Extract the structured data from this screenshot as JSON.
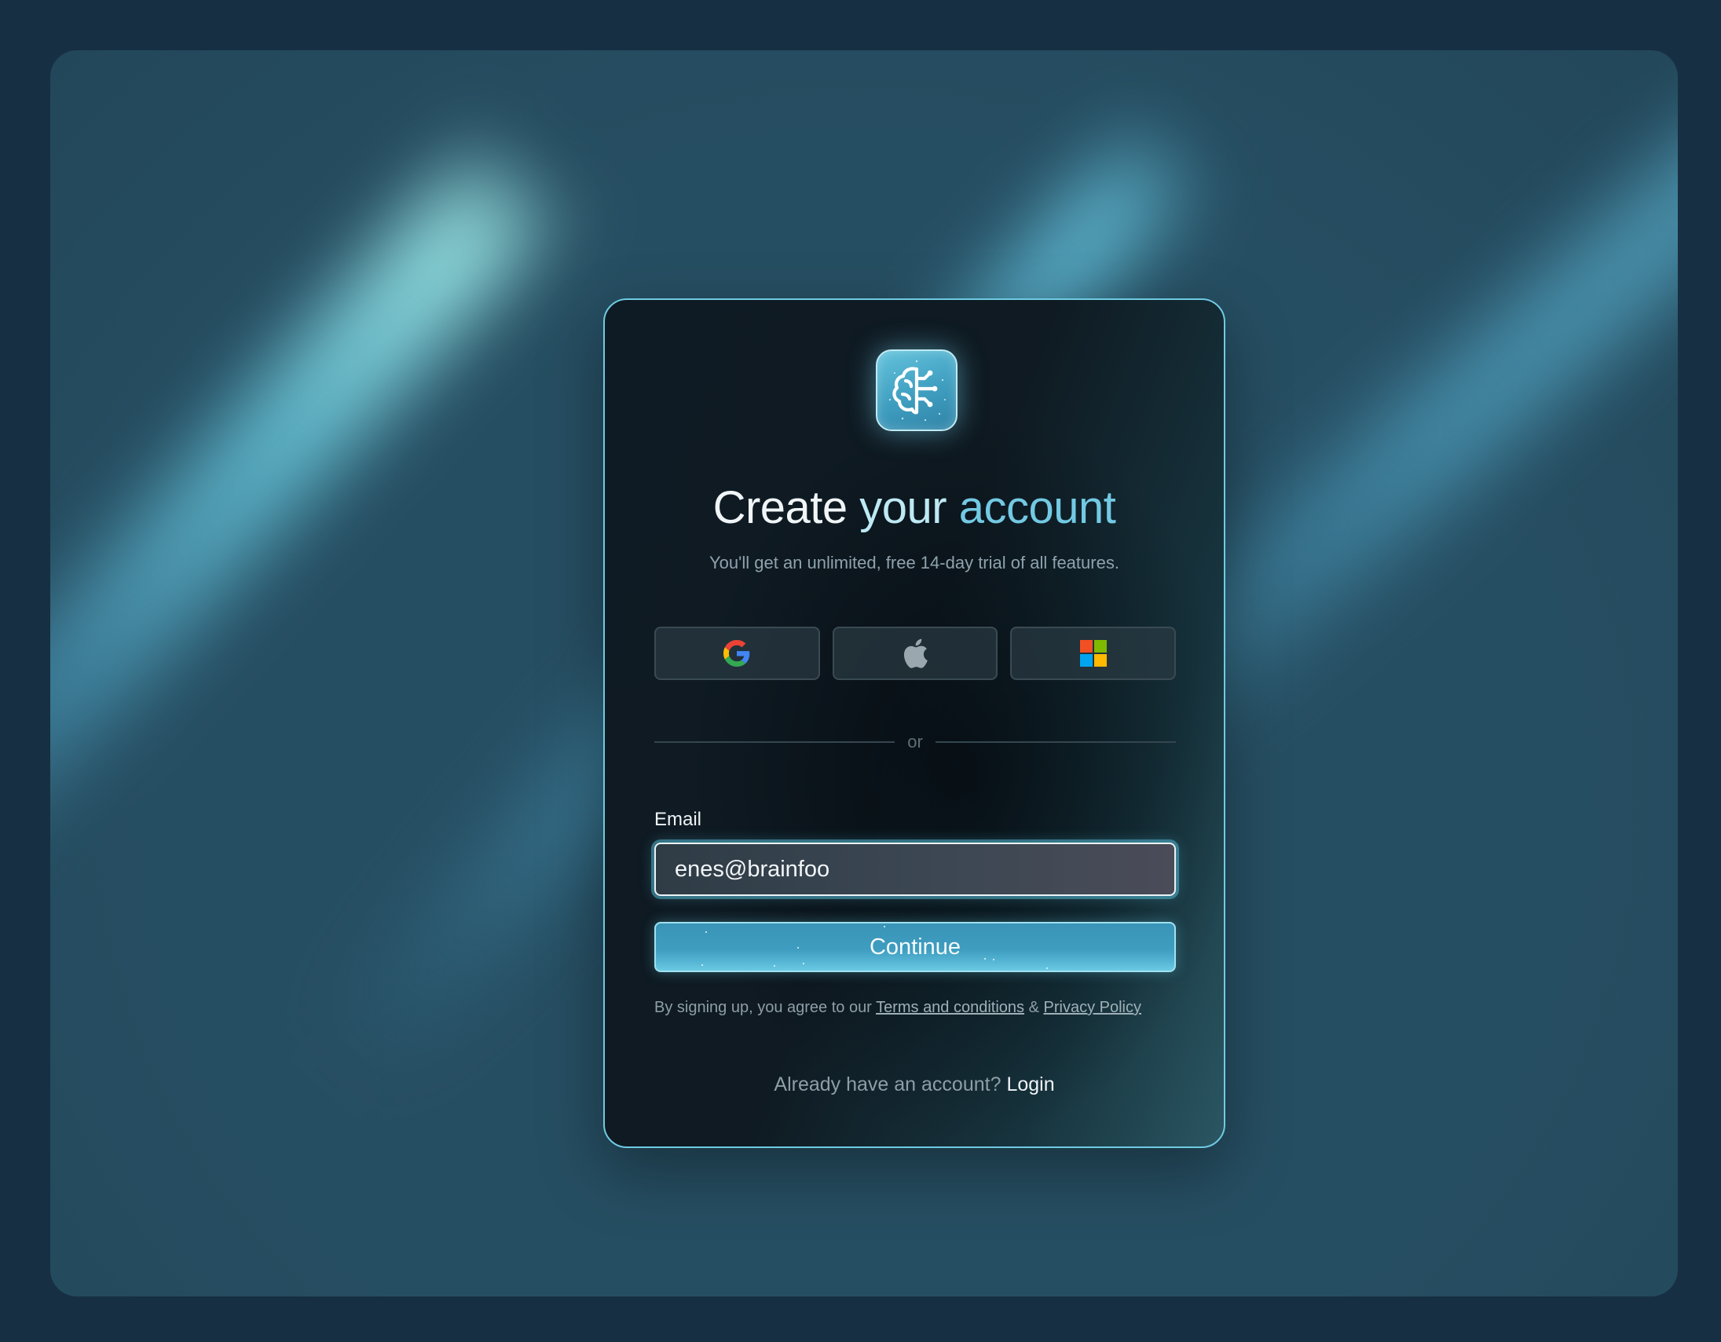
{
  "page": {
    "background_color": "#172f42",
    "panel_color": "#264e62",
    "accent_color": "#6fcbe1"
  },
  "logo": {
    "icon": "brain-circuit-icon"
  },
  "heading": {
    "part1": "Create",
    "part2": "your",
    "part3": "account",
    "subtitle": "You'll get an unlimited, free 14-day trial of all features."
  },
  "social": [
    {
      "provider": "Google",
      "icon": "google-icon"
    },
    {
      "provider": "Apple",
      "icon": "apple-icon"
    },
    {
      "provider": "Microsoft",
      "icon": "microsoft-icon"
    }
  ],
  "divider": {
    "text": "or"
  },
  "form": {
    "email_label": "Email",
    "email_value": "enes@brainfoo",
    "continue_label": "Continue"
  },
  "legal": {
    "prefix": "By signing up, you agree to our",
    "terms_label": "Terms and conditions",
    "separator": "&",
    "privacy_label": "Privacy Policy"
  },
  "footer": {
    "prompt": "Already have an account?",
    "login_label": "Login"
  }
}
